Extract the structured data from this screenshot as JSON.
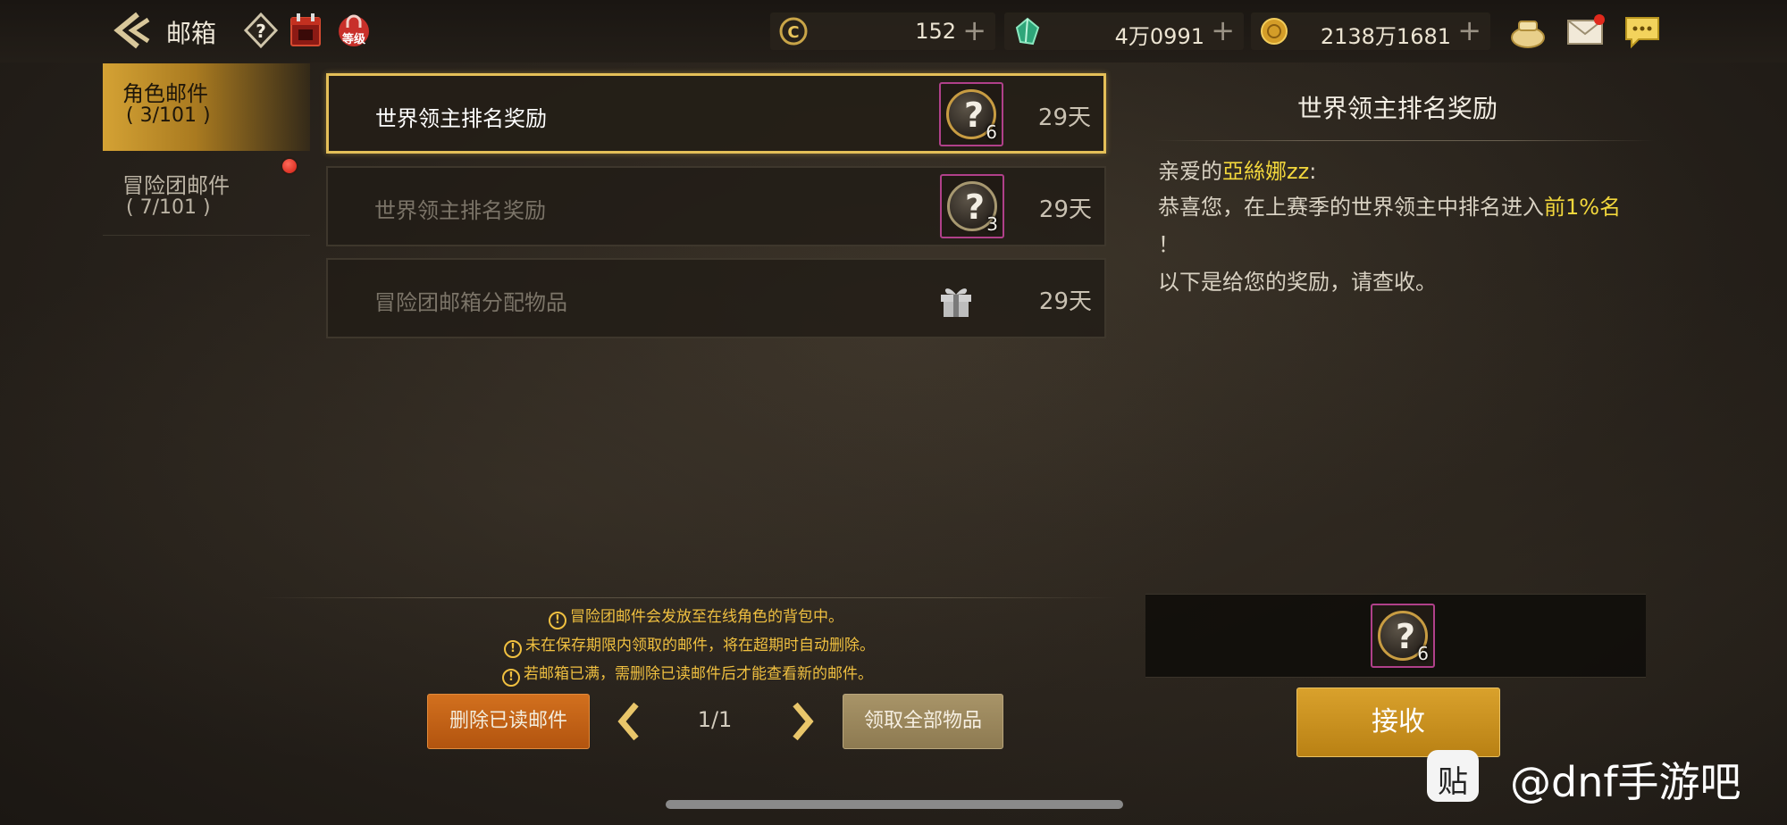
{
  "header": {
    "title": "邮箱",
    "level_badge": "等级",
    "currencies": [
      {
        "name": "coin-c-icon",
        "value": "152"
      },
      {
        "name": "green-gem-icon",
        "value": "4万0991"
      },
      {
        "name": "gold-coin-icon",
        "value": "2138万1681"
      }
    ],
    "plus": "+"
  },
  "tabs": [
    {
      "label": "角色邮件",
      "count": "( 3/101 )",
      "active": true
    },
    {
      "label": "冒险团邮件",
      "count": "( 7/101 )",
      "active": false,
      "has_notification": true
    }
  ],
  "mails": [
    {
      "subject": "世界领主排名奖励",
      "item_qty": "6",
      "days": "29天",
      "selected": true
    },
    {
      "subject": "世界领主排名奖励",
      "item_qty": "3",
      "days": "29天",
      "selected": false
    },
    {
      "subject": "冒险团邮箱分配物品",
      "item": "gift-icon",
      "days": "29天",
      "selected": false
    }
  ],
  "item_symbol": "?",
  "detail": {
    "title": "世界领主排名奖励",
    "greeting_prefix": "亲爱的",
    "player_name": "亞絲娜zz",
    "greeting_suffix": ":",
    "line2_prefix": "恭喜您，在上赛季的世界领主中排名进入",
    "line2_highlight": "前1%名",
    "line3": "！",
    "line4": "以下是给您的奖励，请查收。",
    "reward_qty": "6",
    "receive_label": "接收"
  },
  "notices": [
    "冒险团邮件会发放至在线角色的背包中。",
    "未在保存期限内领取的邮件，将在超期时自动删除。",
    "若邮箱已满，需删除已读邮件后才能查看新的邮件。"
  ],
  "notice_icon": "!",
  "footer": {
    "delete_read_label": "删除已读邮件",
    "page": "1/1",
    "claim_all_label": "领取全部物品"
  },
  "watermark": {
    "logo": "贴",
    "text": "@dnf手游吧"
  },
  "colors": {
    "accent_gold": "#d9a12c",
    "highlight_yellow": "#f2d73c",
    "delete_orange": "#c8621a",
    "notification_red": "#d01c10"
  }
}
